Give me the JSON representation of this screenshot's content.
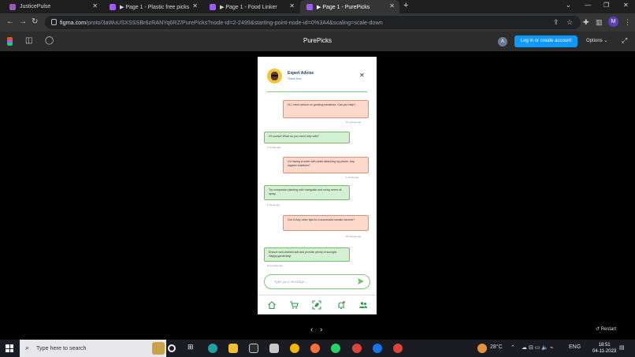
{
  "browser": {
    "tabs": [
      {
        "title": "JusticePulse",
        "color": "#9b59b6"
      },
      {
        "title": "▶ Page 1 - Plastic free picks",
        "color": "#a259ff"
      },
      {
        "title": "▶ Page 1 - Food Linker",
        "color": "#a259ff"
      },
      {
        "title": "▶ Page 1 - PurePicks",
        "color": "#a259ff"
      }
    ],
    "url_host": "figma.com",
    "url_path": "/proto/3aWuUSXSSSBr6zRANYq6RZ/PurePicks?node-id=2-2499&starting-point-node-id=0%3A4&scaling=scale-down",
    "profile_initial": "M"
  },
  "figma": {
    "title": "PurePicks",
    "user_initial": "A",
    "login_label": "Log in or create account",
    "options_label": "Options ⌄",
    "restart_label": "Restart"
  },
  "chat": {
    "expert_name": "Expert Advise",
    "status": "Online Now",
    "messages": [
      {
        "from": "user",
        "text": "Hi, I need advice on growing tomatoes. Can you help?",
        "time": "15 minutes ago"
      },
      {
        "from": "bot",
        "text": "Of course! What do you need help with?",
        "time": "2 minutes ago"
      },
      {
        "from": "user",
        "text": "I'm having trouble with pests attacking my plants. Any organic solutions?",
        "time": "1 minute ago"
      },
      {
        "from": "bot",
        "text": "Try companion planting with marigolds and using neem oil spray.",
        "time": "1 minute ago"
      },
      {
        "from": "user",
        "text": "Got it! Any other tips for a successful tomato harvest?",
        "time": "20 seconds ago"
      },
      {
        "from": "bot",
        "text": "Ensure well-drained soil and provide plenty of sunlight. Happy gardening!",
        "time": "10 seconds ago"
      }
    ],
    "input_placeholder": "Type your message..."
  },
  "taskbar": {
    "search_placeholder": "Type here to search",
    "weather": "28°C",
    "language": "ENG",
    "time": "18:51",
    "date": "04-11-2023"
  },
  "colors": {
    "user_bubble": "#fcd9cb",
    "bot_bubble": "#d4f0d2",
    "accent_green": "#2e9c46",
    "figma_blue": "#0d99ff"
  }
}
